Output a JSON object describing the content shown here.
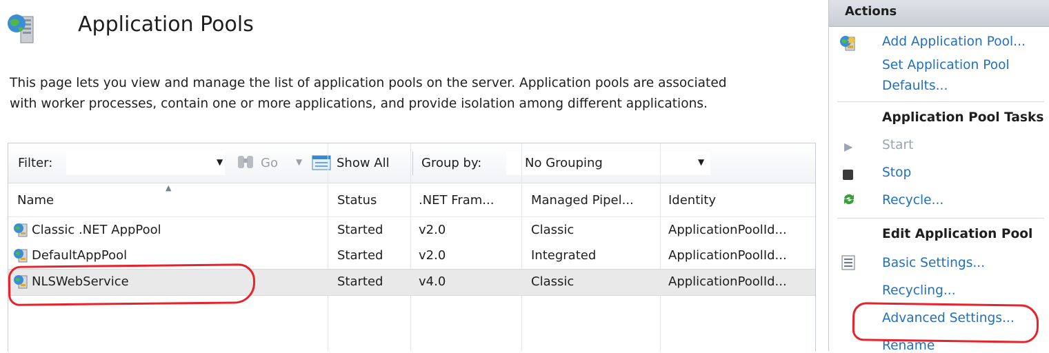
{
  "header": {
    "title": "Application Pools",
    "description": "This page lets you view and manage the list of application pools on the server. Application pools are associated with worker processes, contain one or more applications, and provide isolation among different applications."
  },
  "toolbar": {
    "filter_label": "Filter:",
    "filter_value": "",
    "go_label": "Go",
    "show_all_label": "Show All",
    "group_by_label": "Group by:",
    "group_by_value": "No Grouping"
  },
  "table": {
    "columns": [
      "Name",
      "Status",
      ".NET Fram...",
      "Managed Pipel...",
      "Identity"
    ],
    "rows": [
      {
        "name": "Classic .NET AppPool",
        "status": "Started",
        "framework": "v2.0",
        "pipeline": "Classic",
        "identity": "ApplicationPoolId..."
      },
      {
        "name": "DefaultAppPool",
        "status": "Started",
        "framework": "v2.0",
        "pipeline": "Integrated",
        "identity": "ApplicationPoolId..."
      },
      {
        "name": "NLSWebService",
        "status": "Started",
        "framework": "v4.0",
        "pipeline": "Classic",
        "identity": "ApplicationPoolId..."
      }
    ],
    "selected_row": 2
  },
  "actions": {
    "title": "Actions",
    "add_pool": "Add Application Pool...",
    "set_defaults_line1": "Set Application Pool",
    "set_defaults_line2": "Defaults...",
    "tasks_heading": "Application Pool Tasks",
    "start": "Start",
    "stop": "Stop",
    "recycle": "Recycle...",
    "edit_heading": "Edit Application Pool",
    "basic_settings": "Basic Settings...",
    "recycling": "Recycling...",
    "advanced_settings": "Advanced Settings...",
    "rename": "Rename"
  },
  "colors": {
    "link": "#1f6fbe",
    "highlight": "#e8222a",
    "selected_row": "#e9e9e9"
  },
  "icons": {
    "page": "application-pools-globe-server-icon",
    "row": "application-pool-icon",
    "go": "binoculars-icon",
    "show_all": "show-all-icon",
    "start": "play-icon",
    "stop": "stop-icon",
    "recycle": "recycle-icon",
    "basic_settings": "settings-form-icon"
  }
}
